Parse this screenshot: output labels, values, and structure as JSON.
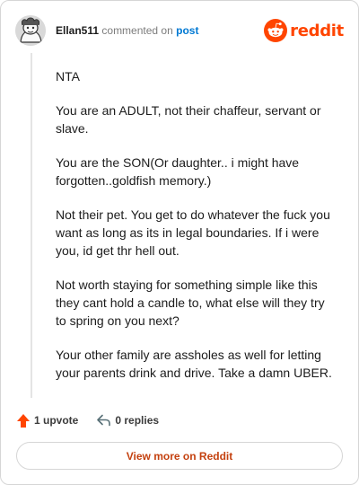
{
  "comment": {
    "username": "Ellan511",
    "action": "commented on",
    "post_link": "post",
    "logo_text": "reddit",
    "paragraphs": [
      "NTA",
      "You are an ADULT, not their chaffeur, servant or slave.",
      "You are the SON(Or daughter.. i might have forgotten..goldfish memory.)",
      "Not their pet. You get to do whatever the fuck you want as long as its in legal boundaries. If i were you, id get thr hell out.",
      "Not worth staying for something simple like this they cant hold a candle to, what else will they try to spring on you next?",
      "Your other family are assholes as well for letting your parents drink and drive. Take a damn UBER."
    ]
  },
  "footer": {
    "upvotes": "1 upvote",
    "replies": "0 replies",
    "view_more": "View more on Reddit"
  },
  "colors": {
    "brand": "#ff4500",
    "link": "#0079d3",
    "upvote": "#ff4500",
    "view_more_text": "#c4410f"
  },
  "icons": {
    "avatar": "snoo-avatar-icon",
    "logo": "reddit-snoo-icon",
    "upvote": "upvote-arrow-icon",
    "reply": "reply-arrow-icon"
  }
}
